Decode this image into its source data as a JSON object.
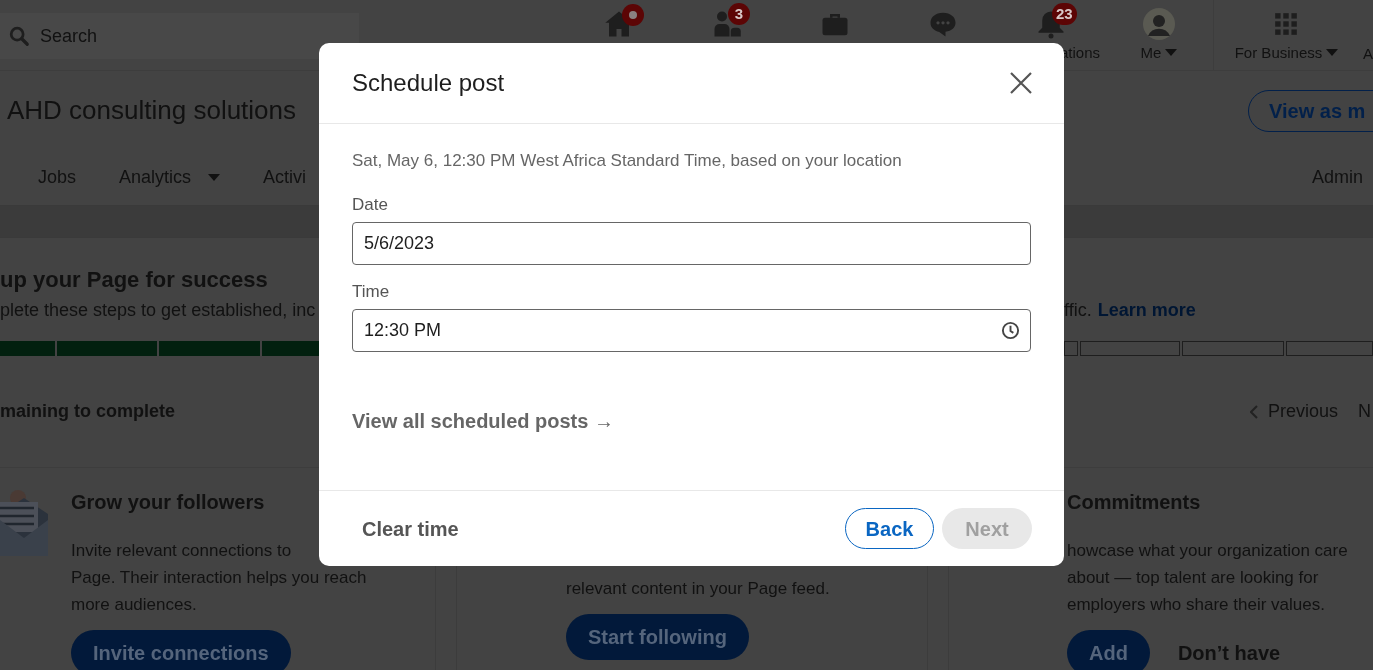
{
  "nav": {
    "search": {
      "placeholder": "Search"
    },
    "items": [
      {
        "kind": "home",
        "dot": true
      },
      {
        "kind": "people",
        "badge": "3"
      },
      {
        "kind": "briefcase"
      },
      {
        "kind": "chat"
      },
      {
        "kind": "bell",
        "badge": "23",
        "label": "ations"
      },
      {
        "kind": "avatar",
        "label": "Me",
        "dropdown": true
      },
      {
        "kind": "grid",
        "label": "For Business",
        "dropdown": true
      }
    ],
    "overflow_label": "A"
  },
  "page": {
    "title": "AHD consulting solutions",
    "view_as_button": "View as m",
    "tabs": [
      {
        "label": "Jobs",
        "dropdown": false
      },
      {
        "label": "Analytics",
        "dropdown": true
      },
      {
        "label": "Activi",
        "dropdown": false
      }
    ],
    "admin_label": "Admin"
  },
  "setup": {
    "title": "up your Page for success",
    "subtitle": "plete these steps to get established, inc",
    "subtitle_end": "ffic.",
    "learn_more": "Learn more",
    "progress_left": [
      {
        "done": true
      },
      {
        "done": true
      },
      {
        "done": true
      },
      {
        "done": true
      }
    ],
    "progress_right": [
      {
        "done": false
      },
      {
        "done": false
      },
      {
        "done": false
      },
      {
        "done": false
      }
    ],
    "remaining": "maining to complete",
    "previous": "Previous",
    "next": "N"
  },
  "cards": [
    {
      "kind": "followers",
      "title": "Grow your followers",
      "lines": [
        "Invite relevant connections to",
        "Page. Their interaction helps you reach",
        "more audiences."
      ],
      "button": "Invite connections"
    },
    {
      "kind": "content",
      "lines": [
        "relevant content in your Page feed."
      ],
      "button": "Start following"
    },
    {
      "kind": "commitments",
      "title": "Commitments",
      "lines": [
        "howcase what your organization care",
        "about — top talent are looking for",
        "employers who share their values."
      ],
      "button": "Add",
      "secondary": "Don’t have"
    }
  ],
  "modal": {
    "title": "Schedule post",
    "info": "Sat, May 6, 12:30 PM West Africa Standard Time, based on your location",
    "fields": [
      {
        "kind": "date",
        "label": "Date",
        "value": "5/6/2023"
      },
      {
        "kind": "time",
        "label": "Time",
        "value": "12:30 PM"
      }
    ],
    "link": "View all scheduled posts →",
    "clear": "Clear time",
    "back": "Back",
    "next": {
      "label": "Next",
      "disabled": true
    }
  }
}
